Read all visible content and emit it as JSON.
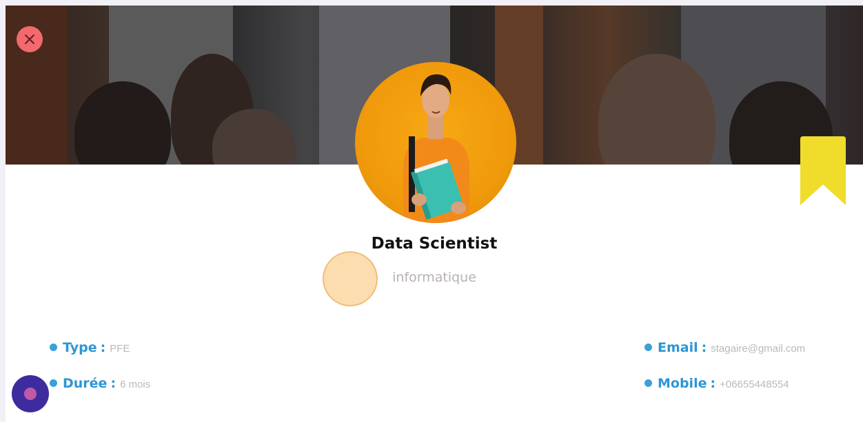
{
  "card": {
    "title": "Data Scientist",
    "category": "informatique"
  },
  "details": {
    "type_label": "Type",
    "type_value": "PFE",
    "duration_label": "Durée",
    "duration_value": "6 mois",
    "email_label": "Email",
    "email_value": "stagaire@gmail.com",
    "mobile_label": "Mobile",
    "mobile_value": "+06655448554"
  },
  "icons": {
    "close": "close-icon",
    "bookmark": "bookmark-icon",
    "assistive": "assistive-touch-icon"
  },
  "colors": {
    "accent": "#2c96d4",
    "close": "#f26a6e",
    "bookmark": "#f0dc2a",
    "avatar_bg": "#f09a0c",
    "assistive": "#3e2b9e"
  }
}
